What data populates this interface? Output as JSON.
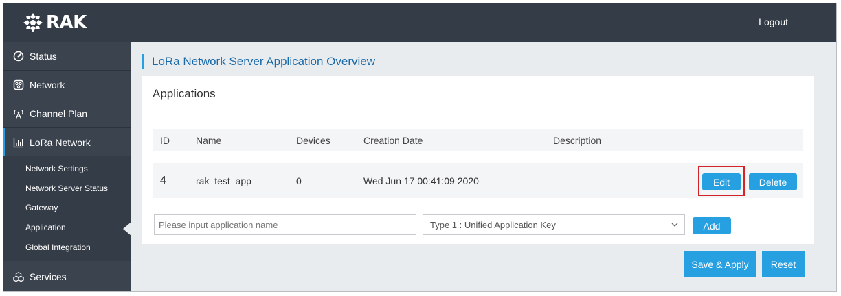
{
  "header": {
    "logo_text": "RAK",
    "logo_icon": "rak-logo-icon",
    "logout_label": "Logout"
  },
  "sidebar": {
    "items": [
      {
        "label": "Status",
        "icon": "gauge-icon"
      },
      {
        "label": "Network",
        "icon": "network-icon"
      },
      {
        "label": "Channel Plan",
        "icon": "antenna-icon"
      },
      {
        "label": "LoRa Network",
        "icon": "bar-chart-icon",
        "active": true
      },
      {
        "label": "Services",
        "icon": "cubes-icon"
      }
    ],
    "submenu": [
      {
        "label": "Network Settings"
      },
      {
        "label": "Network Server Status"
      },
      {
        "label": "Gateway"
      },
      {
        "label": "Application",
        "selected": true
      },
      {
        "label": "Global Integration"
      }
    ]
  },
  "main": {
    "page_title": "LoRa Network Server Application Overview",
    "panel_title": "Applications",
    "table": {
      "columns": [
        "ID",
        "Name",
        "Devices",
        "Creation Date",
        "Description"
      ],
      "rows": [
        {
          "id": "4",
          "name": "rak_test_app",
          "devices": "0",
          "creation_date": "Wed Jun 17 00:41:09 2020",
          "description": ""
        }
      ],
      "edit_label": "Edit",
      "delete_label": "Delete"
    },
    "add_form": {
      "name_placeholder": "Please input application name",
      "type_selected": "Type 1 : Unified Application Key",
      "add_label": "Add"
    },
    "save_apply_label": "Save & Apply",
    "reset_label": "Reset"
  },
  "colors": {
    "header_bg": "#343c47",
    "accent": "#27a0e1",
    "title_blue": "#1a6aa8",
    "highlight_red": "#d2232a",
    "content_bg": "#e9ecef"
  }
}
